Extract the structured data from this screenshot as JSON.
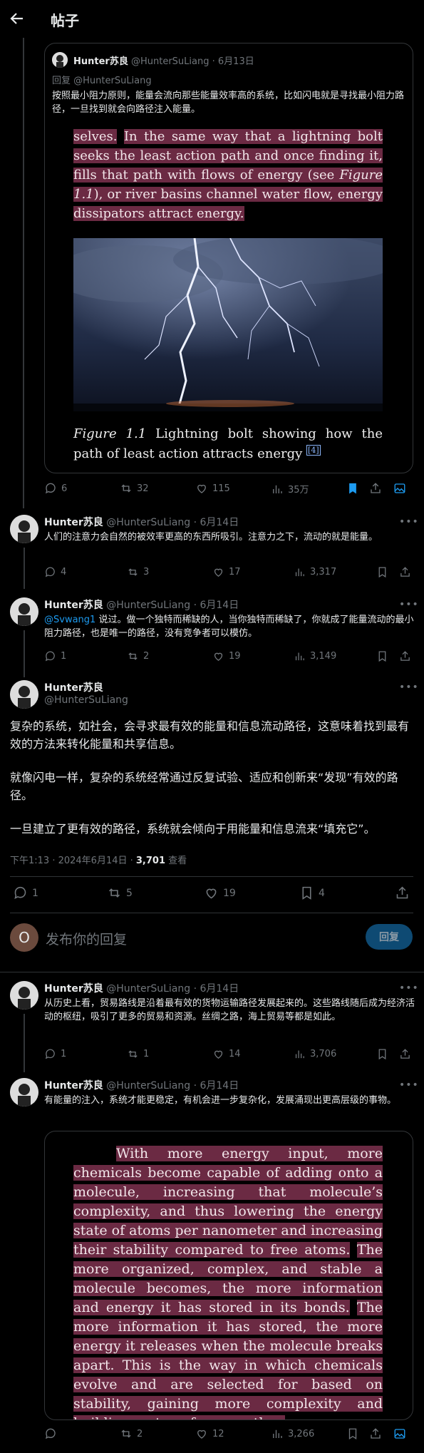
{
  "header": {
    "title": "帖子"
  },
  "quote": {
    "name": "Hunter苏良",
    "handle": "@HunterSuLiang",
    "date": "6月13日",
    "reply_to": "回复 @HunterSuLiang",
    "text": "按照最小阻力原则，能量会流向那些能量效率高的系统，比如闪电就是寻找最小阻力路径，一旦找到就会向路径注入能量。",
    "book_a": "selves.",
    "book_b": "In the same way that a lightning bolt seeks the least action path and once finding it, fills that path with flows of energy (see ",
    "book_fig_ref": "Figure 1.1",
    "book_c": "), or river basins channel water flow, energy dissipators attract energy.",
    "caption_fig": "Figure 1.1",
    "caption_text": " Lightning bolt showing how the path of least action attracts energy ",
    "caption_note": "[4]",
    "stats": {
      "replies": "6",
      "reposts": "32",
      "likes": "115",
      "views": "35万"
    }
  },
  "post1": {
    "name": "Hunter苏良",
    "handle": "@HunterSuLiang",
    "date": "6月14日",
    "text": "人们的注意力会自然的被效率更高的东西所吸引。注意力之下，流动的就是能量。",
    "stats": {
      "replies": "4",
      "reposts": "3",
      "likes": "17",
      "views": "3,317"
    }
  },
  "post2": {
    "name": "Hunter苏良",
    "handle": "@HunterSuLiang",
    "date": "6月14日",
    "mention": "@Svwang1",
    "text": " 说过。做一个独特而稀缺的人，当你独特而稀缺了，你就成了能量流动的最小阻力路径，也是唯一的路径，没有竞争者可以模仿。",
    "stats": {
      "replies": "1",
      "reposts": "2",
      "likes": "19",
      "views": "3,149"
    }
  },
  "main": {
    "name": "Hunter苏良",
    "handle": "@HunterSuLiang",
    "p1": "复杂的系统，如社会，会寻求最有效的能量和信息流动路径，这意味着找到最有效的方法来转化能量和共享信息。",
    "p2": "就像闪电一样，复杂的系统经常通过反复试验、适应和创新来“发现”有效的路径。",
    "p3": "一旦建立了更有效的路径，系统就会倾向于用能量和信息流来“填充它”。",
    "time": "下午1:13 · 2024年6月14日 · ",
    "views": "3,701",
    "views_label": " 查看",
    "stats": {
      "replies": "1",
      "reposts": "5",
      "likes": "19",
      "bookmarks": "4"
    }
  },
  "compose": {
    "avatar_letter": "O",
    "placeholder": "发布你的回复",
    "button": "回复"
  },
  "post3": {
    "name": "Hunter苏良",
    "handle": "@HunterSuLiang",
    "date": "6月14日",
    "text": "从历史上看，贸易路线是沿着最有效的货物运输路径发展起来的。这些路线随后成为经济活动的枢纽，吸引了更多的贸易和资源。丝绸之路，海上贸易等都是如此。",
    "stats": {
      "replies": "1",
      "reposts": "1",
      "likes": "14",
      "views": "3,706"
    }
  },
  "post4": {
    "name": "Hunter苏良",
    "handle": "@HunterSuLiang",
    "date": "6月14日",
    "text": "有能量的注入，系统才能更稳定，有机会进一步复杂化，发展涌现出更高层级的事物。",
    "book_a": "With more energy input, more chemicals become capable of adding onto a molecule, increasing that molecule’s complexity, and thus lowering the energy state of atoms per nanometer and increasing their stability compared to free atoms.",
    "book_b": "The more organized, complex, and stable a molecule becomes, the more information and energy it has stored in its bonds.",
    "book_c": "The more information it has stored, the more energy it releases when the molecule breaks apart. This is the way in which chemicals evolve and are selected for based on stability, gaining more complexity and building on top of one another.",
    "stats": {
      "reposts": "2",
      "likes": "12",
      "views": "3,266"
    }
  }
}
